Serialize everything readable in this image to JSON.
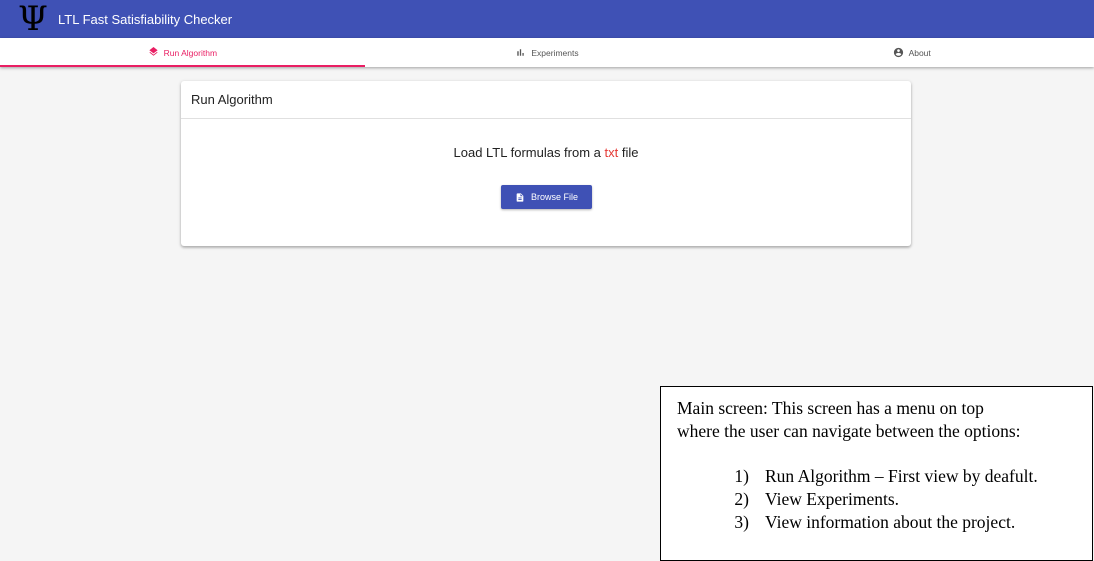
{
  "appbar": {
    "logo": "Ψ",
    "title": "LTL Fast Satisfiability Checker"
  },
  "tabs": [
    {
      "label": "Run Algorithm",
      "icon": "layers-icon"
    },
    {
      "label": "Experiments",
      "icon": "bar-chart-icon"
    },
    {
      "label": "About",
      "icon": "account-circle-icon"
    }
  ],
  "card": {
    "title": "Run Algorithm",
    "load_prefix": "Load LTL formulas from a ",
    "load_accent": "txt",
    "load_suffix": " file",
    "browse_label": "Browse File"
  },
  "note": {
    "line1": "Main screen: This screen has a menu on top",
    "line2": "where the user can navigate between the options:",
    "items": [
      {
        "num": "1)",
        "text": "Run Algorithm – First view by deafult."
      },
      {
        "num": "2)",
        "text": "View Experiments."
      },
      {
        "num": "3)",
        "text": "View information about the project."
      }
    ]
  },
  "colors": {
    "primary": "#3f51b5",
    "accent": "#e91e63",
    "txt_highlight": "#e53935"
  }
}
